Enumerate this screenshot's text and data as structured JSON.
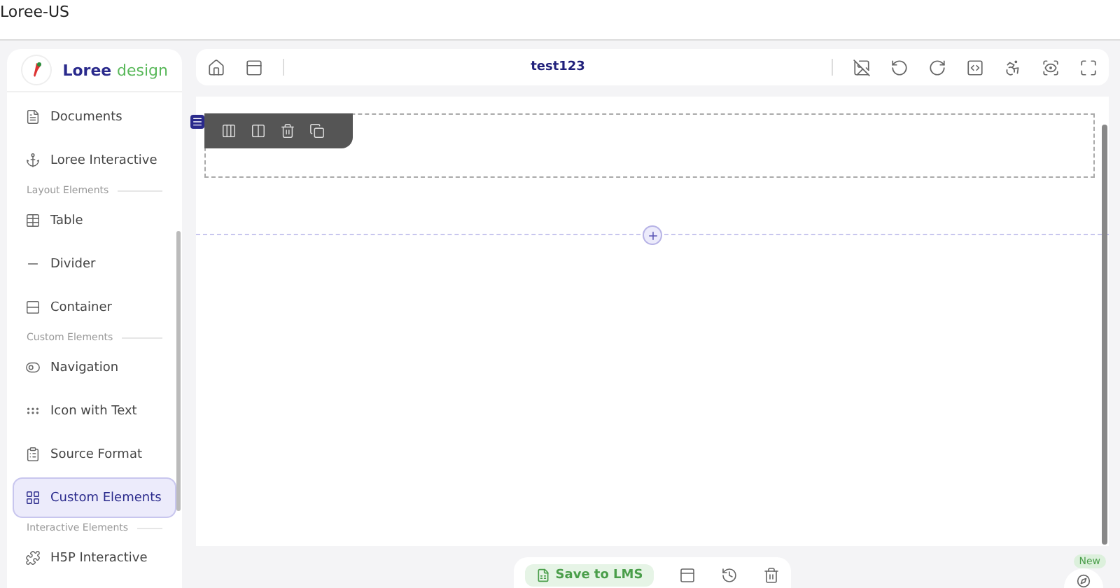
{
  "window": {
    "title": "Loree-US"
  },
  "brand": {
    "primary": "Loree",
    "secondary": "design"
  },
  "sidebar": {
    "items": [
      {
        "kind": "item",
        "label": "Documents",
        "selected": false
      },
      {
        "kind": "item",
        "label": "Loree Interactive",
        "selected": false
      },
      {
        "kind": "section",
        "label": "Layout Elements"
      },
      {
        "kind": "item",
        "label": "Table",
        "selected": false
      },
      {
        "kind": "item",
        "label": "Divider",
        "selected": false
      },
      {
        "kind": "item",
        "label": "Container",
        "selected": false
      },
      {
        "kind": "section",
        "label": "Custom Elements"
      },
      {
        "kind": "item",
        "label": "Navigation",
        "selected": false
      },
      {
        "kind": "item",
        "label": "Icon with Text",
        "selected": false
      },
      {
        "kind": "item",
        "label": "Source Format",
        "selected": false
      },
      {
        "kind": "item",
        "label": "Custom Elements",
        "selected": true
      },
      {
        "kind": "section",
        "label": "Interactive Elements"
      },
      {
        "kind": "item",
        "label": "H5P Interactive",
        "selected": false
      }
    ]
  },
  "toolbar": {
    "title": "test123"
  },
  "bottom_bar": {
    "save_label": "Save to LMS"
  },
  "new_badge": {
    "label": "New"
  }
}
